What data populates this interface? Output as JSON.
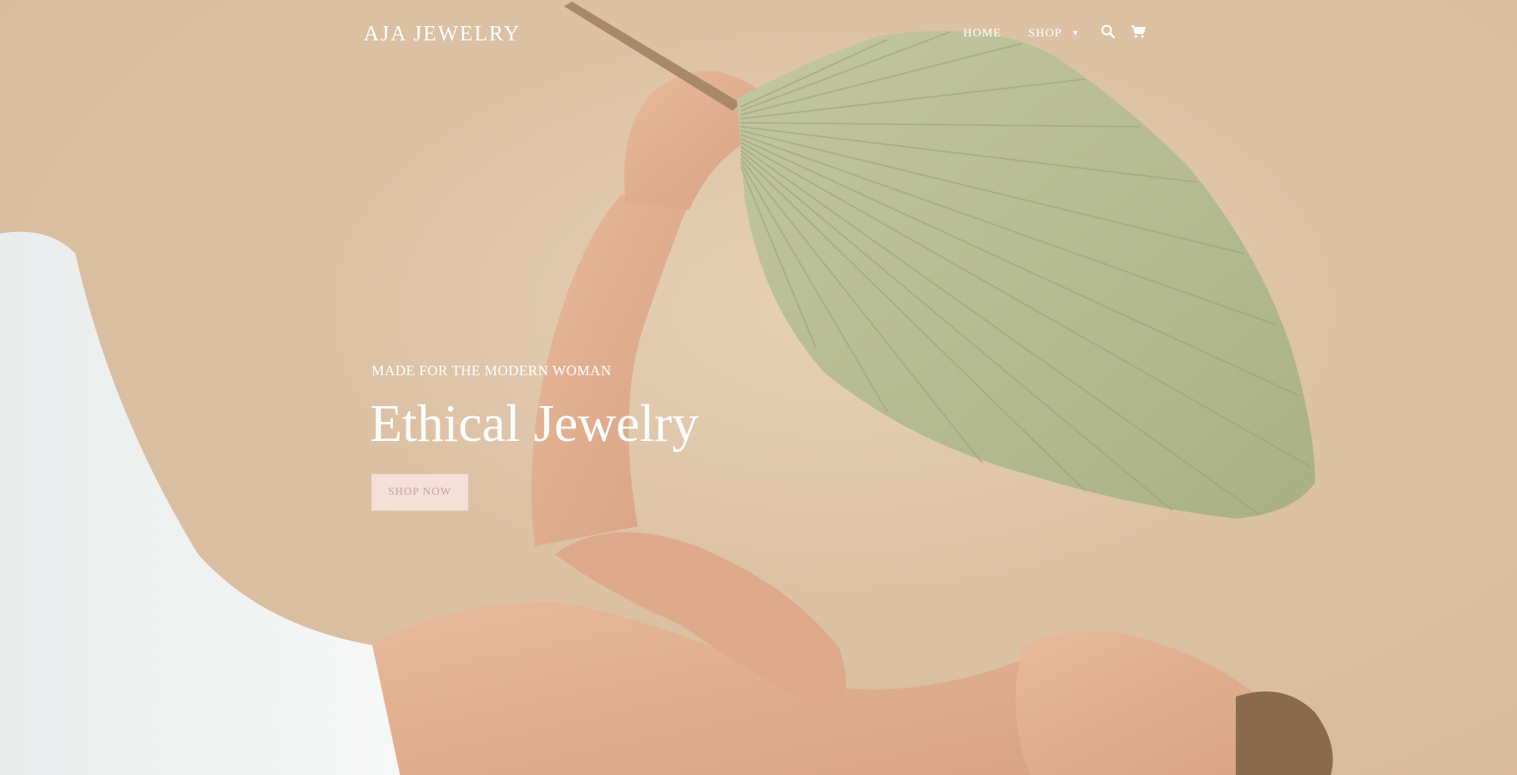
{
  "header": {
    "logo": "AJA JEWELRY",
    "nav": {
      "home_label": "HOME",
      "shop_label": "SHOP"
    },
    "icons": {
      "search": "search-icon",
      "cart": "cart-icon",
      "shop_dropdown": "caret-down-icon"
    }
  },
  "hero": {
    "eyebrow": "MADE FOR THE MODERN WOMAN",
    "headline": "Ethical Jewelry",
    "cta_label": "SHOP NOW",
    "image": "hero-photo-woman-holding-palm-fan"
  },
  "colors": {
    "background": "#dcc1a4",
    "text": "#ffffff",
    "cta_bg": "#f5dfd9",
    "cta_text": "#c9a49a",
    "leaf": "#b8bf98"
  }
}
